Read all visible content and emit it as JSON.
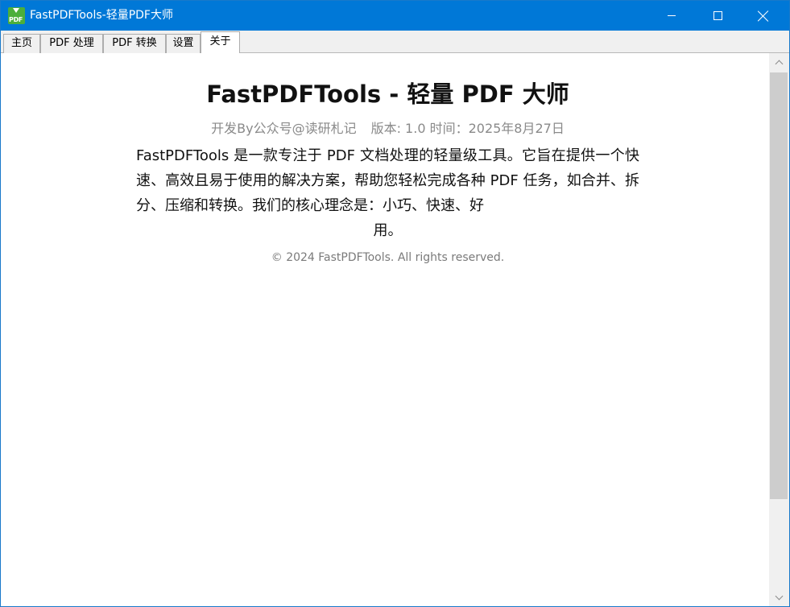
{
  "window": {
    "title": "FastPDFTools-轻量PDF大师",
    "app_icon_text": "PDF",
    "accent_color": "#0078d7"
  },
  "tabs": [
    {
      "label": "主页",
      "active": false
    },
    {
      "label": "PDF 处理",
      "active": false
    },
    {
      "label": "PDF 转换",
      "active": false
    },
    {
      "label": "设置",
      "active": false
    },
    {
      "label": "关于",
      "active": true
    }
  ],
  "about": {
    "heading": "FastPDFTools - 轻量 PDF 大师",
    "developer": "开发By公众号@读研札记",
    "version_info": "版本: 1.0 时间：2025年8月27日",
    "description_main": "FastPDFTools 是一款专注于 PDF 文档处理的轻量级工具。它旨在提供一个快速、高效且易于使用的解决方案，帮助您轻松完成各种 PDF 任务，如合并、拆分、压缩和转换。我们的核心理念是：小巧、快速、好",
    "description_end": "用。",
    "copyright": "© 2024 FastPDFTools. All rights reserved."
  }
}
